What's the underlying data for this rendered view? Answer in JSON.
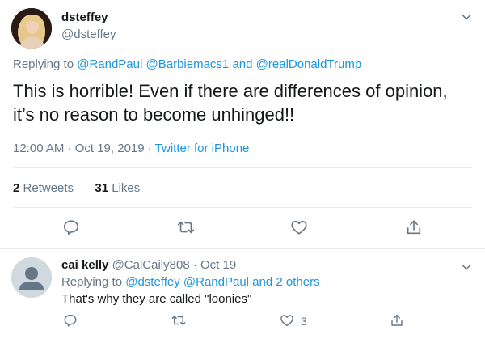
{
  "main_tweet": {
    "display_name": "dsteffey",
    "handle": "@dsteffey",
    "replying_prefix": "Replying to",
    "replying_to": [
      "@RandPaul",
      "@Barbiemacs1",
      "@realDonaldTrump"
    ],
    "replying_and": "and",
    "text": "This is horrible! Even if there are differences of opinion, it’s no reason to become unhinged!!",
    "time": "12:00 AM · Oct 19, 2019 · ",
    "source": "Twitter for iPhone",
    "retweets_count": "2",
    "retweets_label": "Retweets",
    "likes_count": "31",
    "likes_label": "Likes",
    "icons": [
      "reply-icon",
      "retweet-icon",
      "like-icon",
      "share-icon",
      "chevron-down-icon"
    ]
  },
  "reply": {
    "display_name": "cai kelly",
    "handle": "@CaiCaily808",
    "date": "· Oct 19",
    "replying_prefix": "Replying to",
    "replying_to": [
      "@dsteffey",
      "@RandPaul"
    ],
    "replying_and": "and",
    "replying_others": "2 others",
    "text": "That's why they are called \"loonies\"",
    "like_count": "3"
  },
  "colors": {
    "link": "#1b95e0",
    "secondary_text": "#657786",
    "primary_text": "#14171a",
    "divider": "#e6ecf0"
  }
}
